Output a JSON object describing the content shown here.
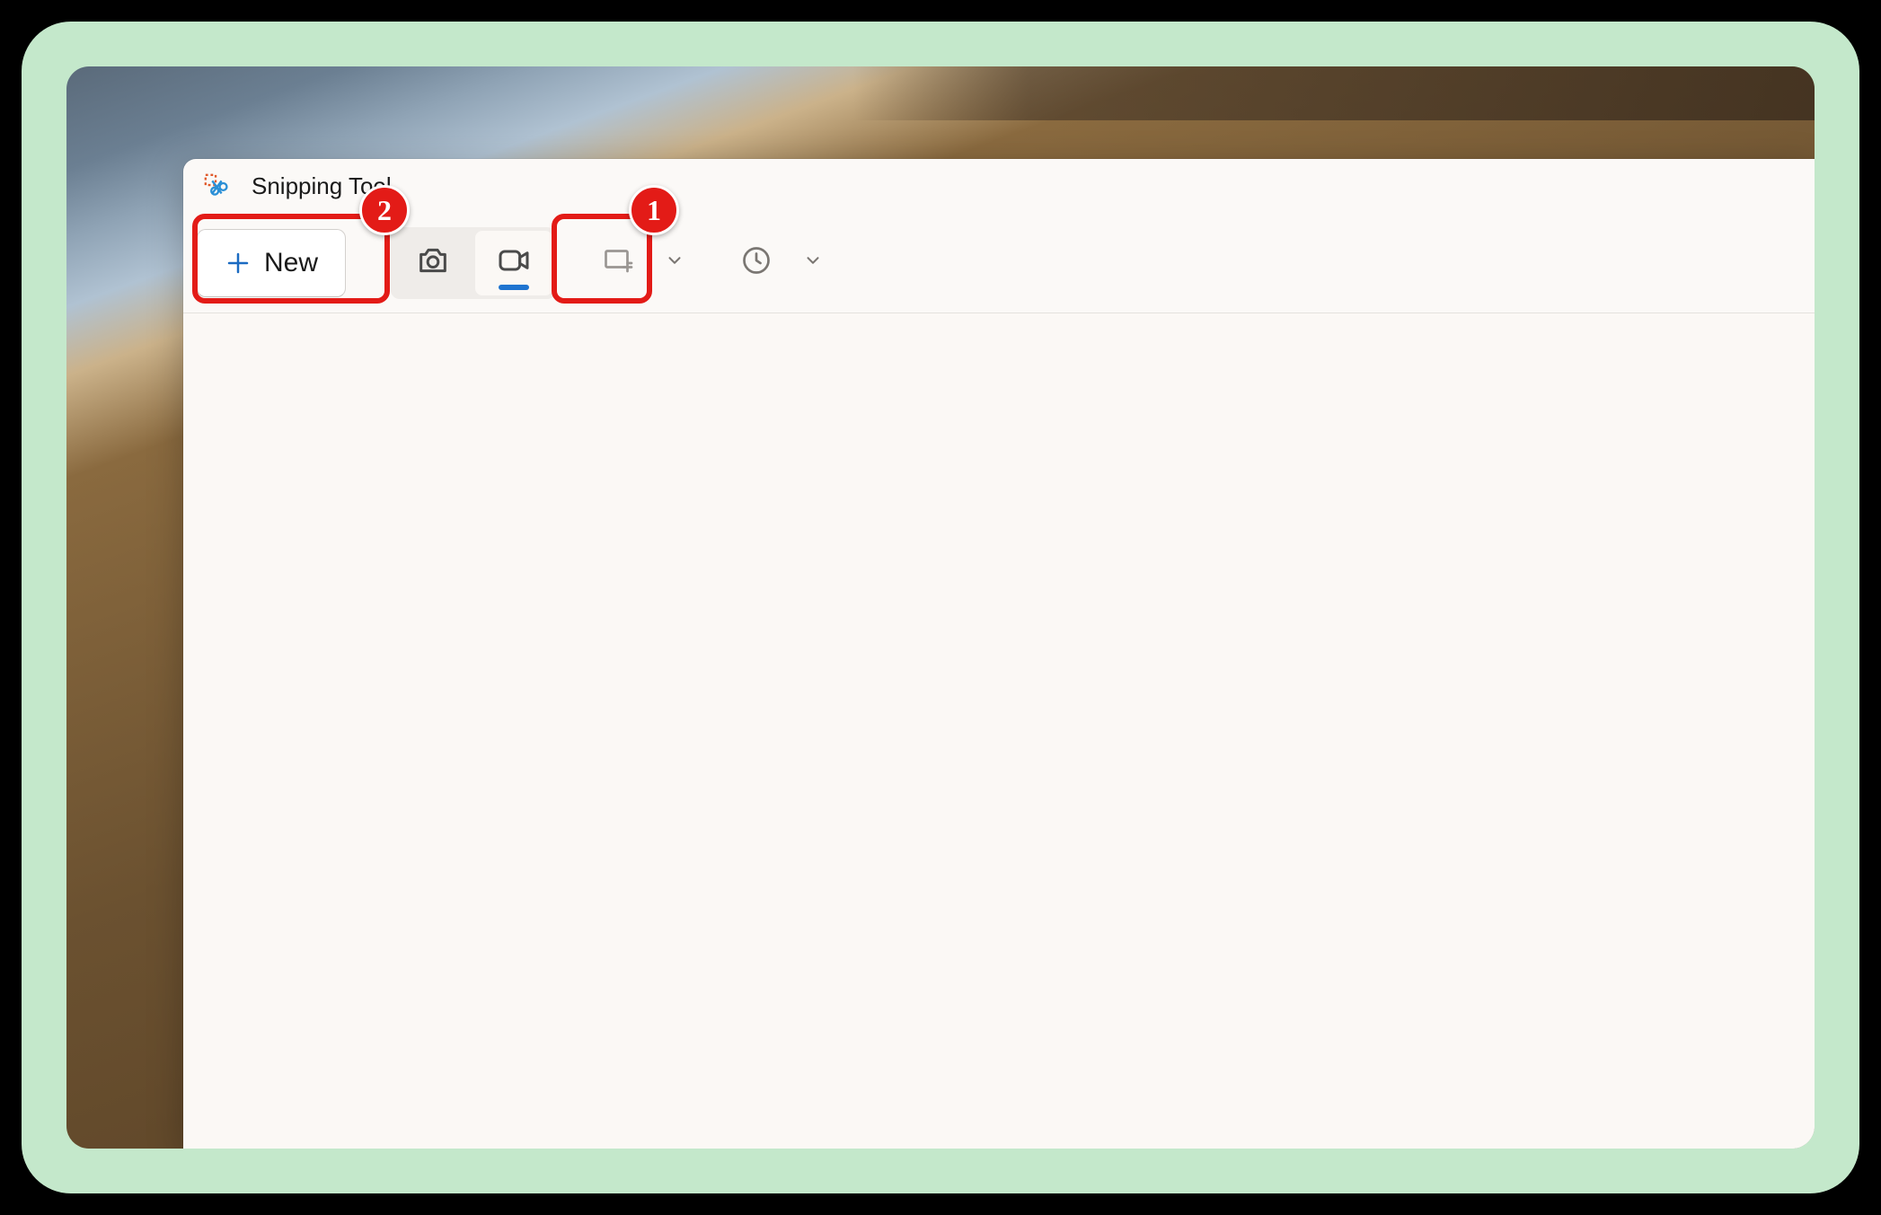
{
  "app": {
    "title": "Snipping Tool"
  },
  "toolbar": {
    "new_label": "New",
    "modes": {
      "snapshot": {
        "name": "snapshot",
        "selected": false
      },
      "record": {
        "name": "record",
        "selected": true
      }
    },
    "snip_shape": {
      "enabled": false
    },
    "delay": {
      "enabled": true
    }
  },
  "annotations": {
    "step1": {
      "label": "1",
      "target": "record-mode-button"
    },
    "step2": {
      "label": "2",
      "target": "new-button"
    }
  },
  "colors": {
    "accent": "#1f74d0",
    "annotation": "#e31b17",
    "card_bg": "#c4e8cb"
  }
}
